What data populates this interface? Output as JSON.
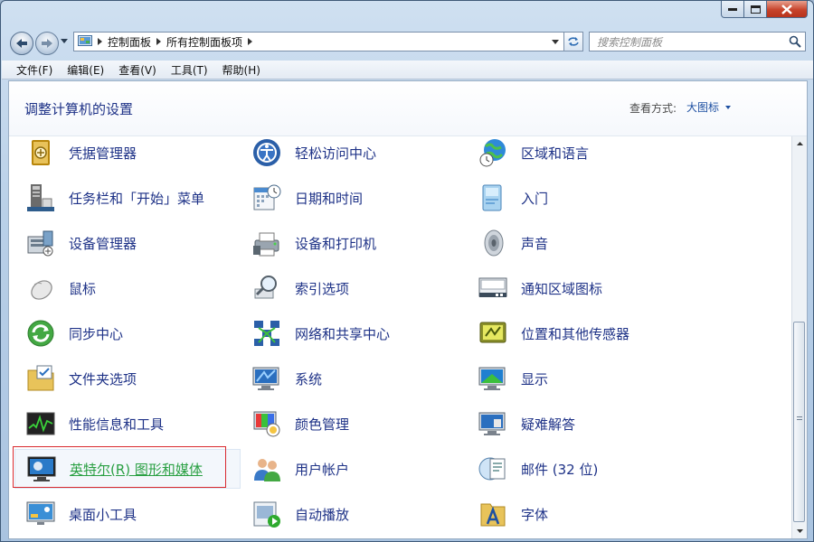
{
  "address": {
    "crumbs": [
      "控制面板",
      "所有控制面板项"
    ]
  },
  "search": {
    "placeholder": "搜索控制面板"
  },
  "menu": [
    "文件(F)",
    "编辑(E)",
    "查看(V)",
    "工具(T)",
    "帮助(H)"
  ],
  "header": {
    "title": "调整计算机的设置",
    "view_by_label": "查看方式:",
    "view_by_value": "大图标"
  },
  "items": [
    [
      "凭据管理器",
      "任务栏和「开始」菜单",
      "设备管理器",
      "鼠标",
      "同步中心",
      "文件夹选项",
      "性能信息和工具",
      "英特尔(R) 图形和媒体",
      "桌面小工具"
    ],
    [
      "轻松访问中心",
      "日期和时间",
      "设备和打印机",
      "索引选项",
      "网络和共享中心",
      "系统",
      "颜色管理",
      "用户帐户",
      "自动播放"
    ],
    [
      "区域和语言",
      "入门",
      "声音",
      "通知区域图标",
      "位置和其他传感器",
      "显示",
      "疑难解答",
      "邮件 (32 位)",
      "字体"
    ]
  ],
  "icons": [
    [
      "vault-icon",
      "taskbar-icon",
      "device-manager-icon",
      "mouse-icon",
      "sync-icon",
      "folder-options-icon",
      "performance-icon",
      "intel-graphics-icon",
      "gadgets-icon"
    ],
    [
      "ease-of-access-icon",
      "calendar-clock-icon",
      "printer-icon",
      "magnifier-icon",
      "network-icon",
      "system-icon",
      "color-management-icon",
      "users-icon",
      "autoplay-icon"
    ],
    [
      "globe-clock-icon",
      "getting-started-icon",
      "speaker-icon",
      "notification-icon",
      "sensor-icon",
      "display-icon",
      "troubleshoot-icon",
      "mail-icon",
      "fonts-icon"
    ]
  ],
  "highlighted_item": "英特尔(R) 图形和媒体",
  "colors": {
    "link": "#1e3287",
    "highlight_text": "#2aa043",
    "highlight_border": "#d9292f"
  }
}
